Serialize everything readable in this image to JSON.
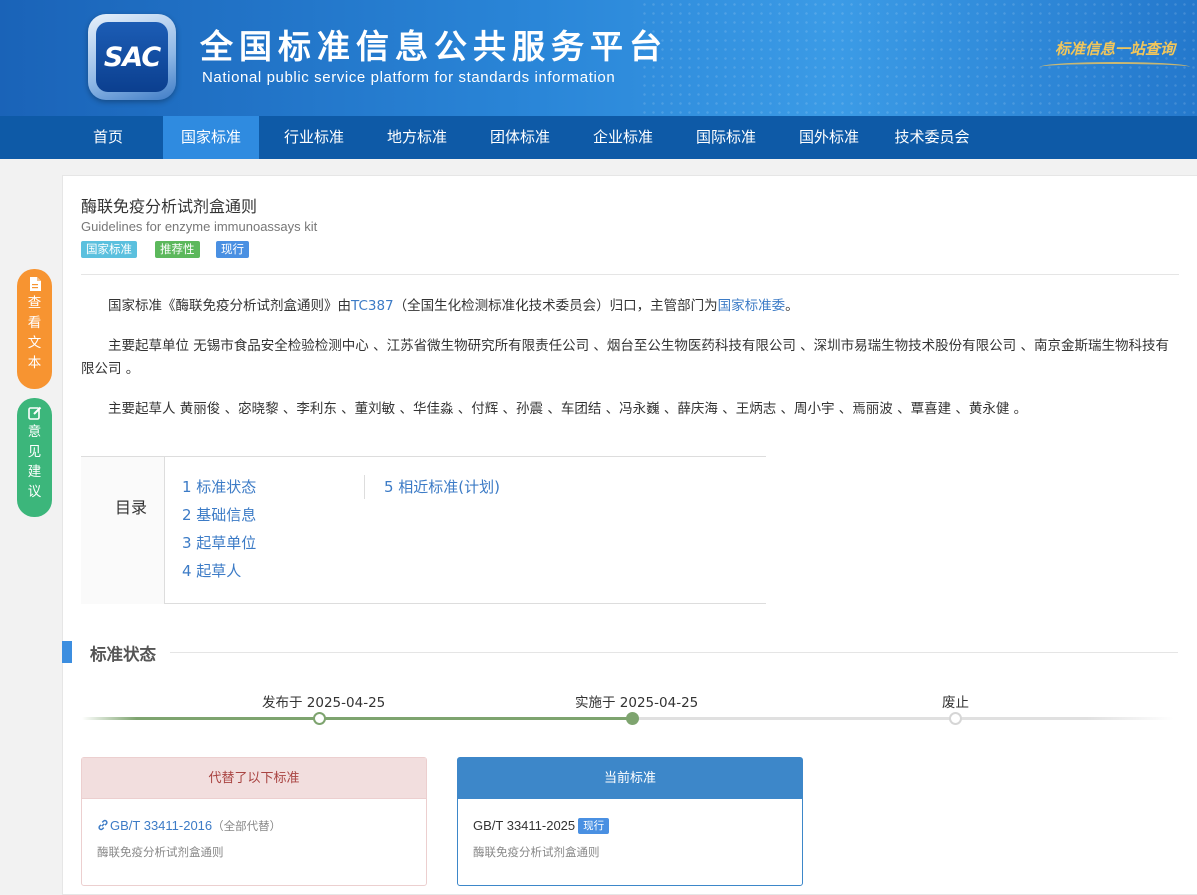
{
  "header": {
    "logo_text": "SAC",
    "title": "全国标准信息公共服务平台",
    "subtitle": "National public service platform  for standards information",
    "slogan": "标准信息一站查询"
  },
  "nav": {
    "items": [
      {
        "label": "首页",
        "active": false
      },
      {
        "label": "国家标准",
        "active": true
      },
      {
        "label": "行业标准",
        "active": false
      },
      {
        "label": "地方标准",
        "active": false
      },
      {
        "label": "团体标准",
        "active": false
      },
      {
        "label": "企业标准",
        "active": false
      },
      {
        "label": "国际标准",
        "active": false
      },
      {
        "label": "国外标准",
        "active": false
      },
      {
        "label": "技术委员会",
        "active": false
      }
    ]
  },
  "side": {
    "view_text_label": "查看文本",
    "feedback_label": "意见建议",
    "view_text_icon": "document-icon",
    "feedback_icon": "edit-icon"
  },
  "doc": {
    "title": "酶联免疫分析试剂盒通则",
    "title_en": "Guidelines for enzyme immunoassays kit",
    "tags": [
      "国家标准",
      "推荐性",
      "现行"
    ],
    "summary": {
      "prefix": "国家标准《酶联免疫分析试剂盒通则》由",
      "tc_link": "TC387",
      "middle": "（全国生化检测标准化技术委员会）归口，主管部门为",
      "dept_link": "国家标准委",
      "suffix": "。"
    },
    "drafting_units": "主要起草单位 无锡市食品安全检验检测中心 、江苏省微生物研究所有限责任公司 、烟台至公生物医药科技有限公司 、深圳市易瑞生物技术股份有限公司 、南京金斯瑞生物科技有限公司 。",
    "drafters": "主要起草人 黄丽俊 、宓晓黎 、李利东 、董刘敏 、华佳淼 、付辉 、孙震 、车团结 、冯永巍 、薛庆海 、王炳志 、周小宇 、焉丽波 、覃喜建 、黄永健 。"
  },
  "toc": {
    "label": "目录",
    "items": [
      "1  标准状态",
      "2  基础信息",
      "3  起草单位",
      "4  起草人",
      "5  相近标准(计划)"
    ]
  },
  "status": {
    "section_title": "标准状态",
    "published": "发布于 2025-04-25",
    "implemented": "实施于 2025-04-25",
    "abolished": "废止",
    "progress_fraction": 0.5
  },
  "replaced": {
    "head": "代替了以下标准",
    "code": "GB/T 33411-2016",
    "note": "（全部代替）",
    "name": "酶联免疫分析试剂盒通则",
    "icon": "link-icon"
  },
  "current": {
    "head": "当前标准",
    "code": "GB/T 33411-2025",
    "badge": "现行",
    "name": "酶联免疫分析试剂盒通则"
  },
  "colors": {
    "header_blue": "#1a63b8",
    "nav_blue": "#0e5aa7",
    "nav_active": "#2f8be0",
    "link": "#3c7bc6",
    "timeline_green": "#7ea46f",
    "orange_button": "#f79431",
    "green_button": "#3cb67b"
  }
}
